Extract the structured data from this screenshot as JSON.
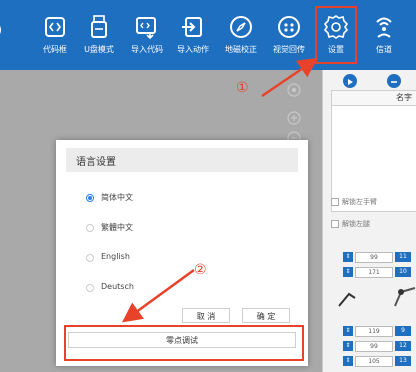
{
  "toolbar": {
    "items": [
      {
        "label": "代码框",
        "icon": "code-icon"
      },
      {
        "label": "U盘模式",
        "icon": "usb-icon"
      },
      {
        "label": "导入代码",
        "icon": "import-code-icon"
      },
      {
        "label": "导入动作",
        "icon": "import-action-icon"
      },
      {
        "label": "地磁校正",
        "icon": "compass-icon"
      },
      {
        "label": "视觉回传",
        "icon": "vision-icon"
      },
      {
        "label": "设置",
        "icon": "gear-icon"
      },
      {
        "label": "信道",
        "icon": "signal-icon"
      }
    ]
  },
  "right_panel": {
    "name_header": "名字",
    "checkbox_1": "解锁左手臂",
    "checkbox_2": "解锁左腿",
    "sliders_top": [
      {
        "value": "99",
        "index": "11"
      },
      {
        "value": "171",
        "index": "10"
      }
    ],
    "sliders_bottom": [
      {
        "value": "119",
        "index": "9"
      },
      {
        "value": "99",
        "index": "12"
      },
      {
        "value": "105",
        "index": "13"
      }
    ]
  },
  "dialog": {
    "title": "语言设置",
    "options": [
      "简体中文",
      "繁體中文",
      "English",
      "Deutsch"
    ],
    "selected_option": "简体中文",
    "cancel_label": "取 消",
    "confirm_label": "确 定",
    "zero_debug_label": "零点调试"
  },
  "annotations": {
    "marker_1": "①",
    "marker_2": "②"
  },
  "colors": {
    "toolbar": "#1f6fc0",
    "annotation": "#e8432a",
    "radio_selected": "#2d7ff0"
  }
}
